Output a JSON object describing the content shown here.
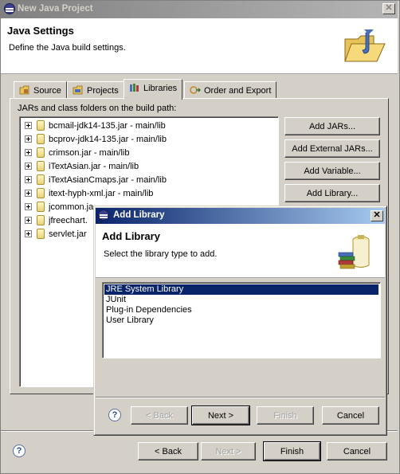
{
  "window": {
    "title": "New Java Project",
    "banner_title": "Java Settings",
    "banner_description": "Define the Java build settings."
  },
  "tabs": [
    {
      "label": "Source",
      "icon": "source-icon"
    },
    {
      "label": "Projects",
      "icon": "projects-icon"
    },
    {
      "label": "Libraries",
      "icon": "libraries-icon",
      "active": true
    },
    {
      "label": "Order and Export",
      "icon": "order-export-icon"
    }
  ],
  "libraries_panel": {
    "list_label": "JARs and class folders on the build path:",
    "jars": [
      "bcmail-jdk14-135.jar - main/lib",
      "bcprov-jdk14-135.jar - main/lib",
      "crimson.jar - main/lib",
      "iTextAsian.jar - main/lib",
      "iTextAsianCmaps.jar - main/lib",
      "itext-hyph-xml.jar - main/lib",
      "jcommon.ja",
      "jfreechart.",
      "servlet.jar"
    ],
    "buttons": {
      "add_jars": "Add JARs...",
      "add_external_jars": "Add External JARs...",
      "add_variable": "Add Variable...",
      "add_library": "Add Library..."
    }
  },
  "footer": {
    "back": "< Back",
    "next": "Next >",
    "finish": "Finish",
    "cancel": "Cancel"
  },
  "dialog": {
    "title": "Add Library",
    "banner_title": "Add Library",
    "banner_description": "Select the library type to add.",
    "library_types": [
      {
        "label": "JRE System Library",
        "selected": true
      },
      {
        "label": "JUnit"
      },
      {
        "label": "Plug-in Dependencies"
      },
      {
        "label": "User Library"
      }
    ],
    "buttons": {
      "back": "< Back",
      "next": "Next >",
      "finish": "Finish",
      "cancel": "Cancel"
    }
  },
  "colors": {
    "dialog_title_start": "#0a246a",
    "dialog_title_end": "#a6caf0",
    "selection": "#0a246a",
    "window_face": "#d4d0c8"
  }
}
